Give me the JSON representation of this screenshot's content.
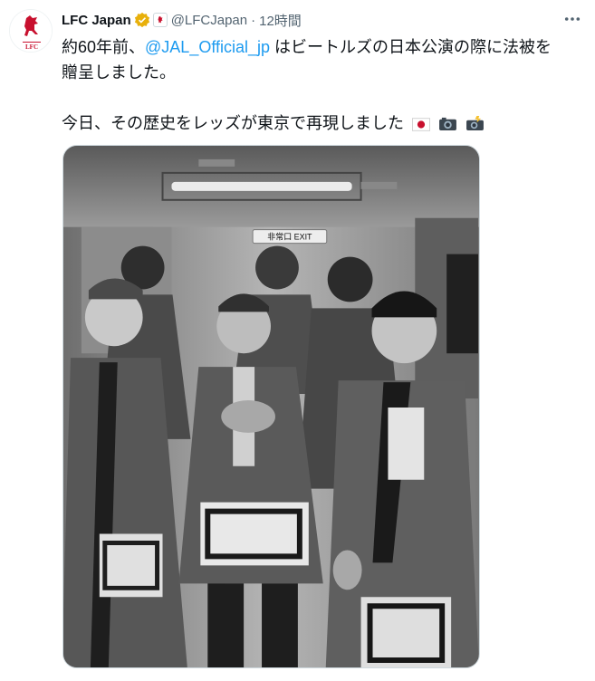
{
  "tweet": {
    "display_name": "LFC Japan",
    "handle": "@LFCJapan",
    "separator": "·",
    "time": "12時間",
    "text_line1_prefix": "約60年前、",
    "mention": "@JAL_Official_jp",
    "text_line1_suffix": " はビートルズの日本公演の際に法被を",
    "text_line2": "贈呈しました。",
    "text_line3": "今日、その歴史をレッズが東京で再現しました",
    "emojis": [
      "japan-flag",
      "camera",
      "camera-with-flash"
    ],
    "avatar_text": "LFC",
    "media_sign_text": "非常口 EXIT"
  },
  "colors": {
    "mention": "#1d9bf0",
    "verified_badge": "#e8b00b",
    "brand_red": "#c8102e",
    "muted_text": "#536471"
  }
}
